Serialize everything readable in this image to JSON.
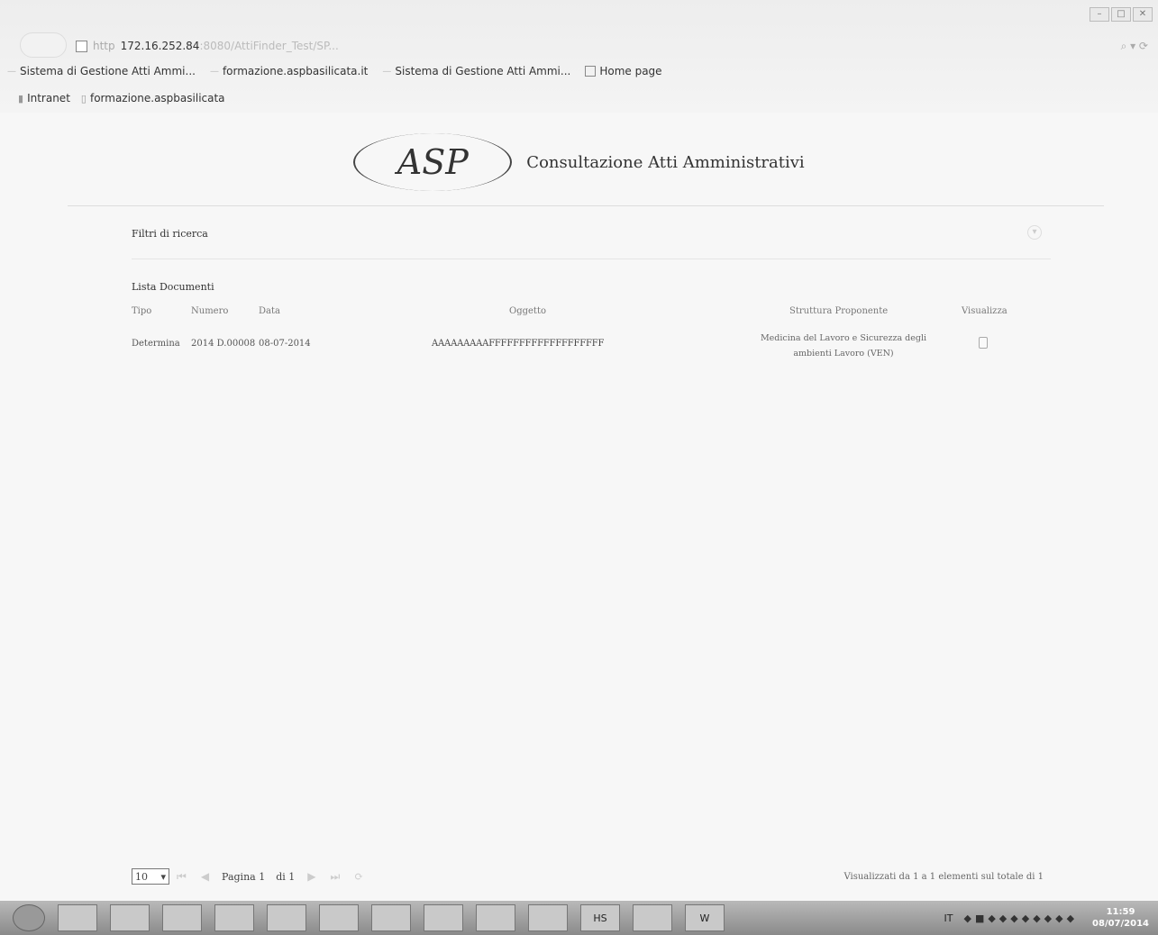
{
  "browser": {
    "url": {
      "protocol": "http",
      "host": "172.16.252.84",
      "rest": ":8080/AttiFinder_Test/SP..."
    },
    "tabs": [
      {
        "label": "Sistema di Gestione Atti Ammi..."
      },
      {
        "label": "formazione.aspbasilicata.it"
      },
      {
        "label": "Sistema di Gestione Atti Ammi..."
      },
      {
        "label": "Home page"
      }
    ],
    "favorites": [
      {
        "label": "Intranet"
      },
      {
        "label": "formazione.aspbasilicata"
      }
    ]
  },
  "header": {
    "logo_text": "ASP",
    "title": "Consultazione Atti Amministrativi"
  },
  "filters": {
    "label": "Filtri di ricerca"
  },
  "documents": {
    "title": "Lista Documenti",
    "columns": [
      "Tipo",
      "Numero",
      "Data",
      "Oggetto",
      "Struttura Proponente",
      "Visualizza"
    ],
    "rows": [
      {
        "tipo": "Determina",
        "numero": "2014 D.00008",
        "data": "08-07-2014",
        "oggetto": "AAAAAAAAAFFFFFFFFFFFFFFFFFFF",
        "struttura": "Medicina del Lavoro e Sicurezza degli ambienti Lavoro (VEN)"
      }
    ]
  },
  "pager": {
    "page_size": "10",
    "page_label": "Pagina 1",
    "of_label": "di 1",
    "info": "Visualizzati da 1 a 1 elementi sul totale di 1"
  },
  "taskbar": {
    "lang": "IT",
    "time": "11:59",
    "date": "08/07/2014",
    "word_label": "W",
    "hs_label": "HS"
  }
}
